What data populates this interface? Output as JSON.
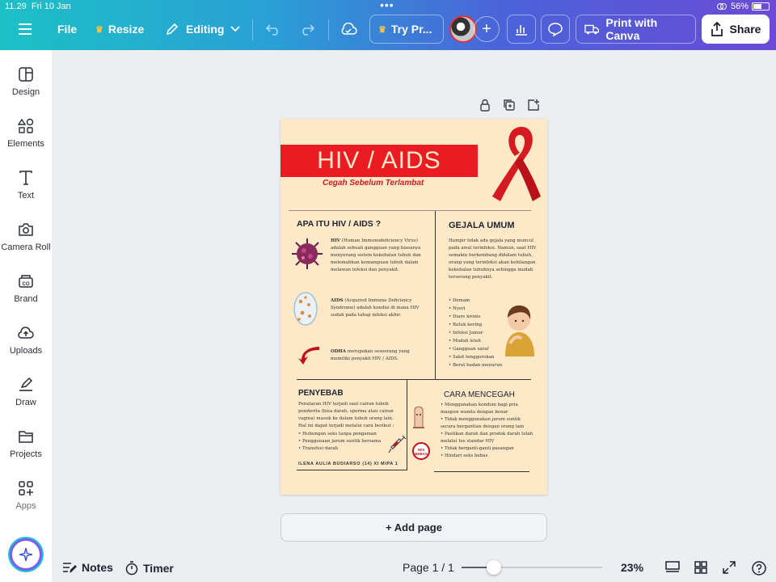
{
  "status": {
    "time": "11.29",
    "date": "Fri 10 Jan",
    "battery": "56%"
  },
  "toolbar": {
    "file": "File",
    "resize": "Resize",
    "mode": "Editing",
    "try_pro": "Try Pr...",
    "print": "Print with Canva",
    "share": "Share"
  },
  "sidebar": {
    "items": [
      {
        "label": "Design",
        "icon": "design-icon"
      },
      {
        "label": "Elements",
        "icon": "elements-icon"
      },
      {
        "label": "Text",
        "icon": "text-icon"
      },
      {
        "label": "Camera Roll",
        "icon": "camera-icon"
      },
      {
        "label": "Brand",
        "icon": "brand-icon"
      },
      {
        "label": "Uploads",
        "icon": "uploads-icon"
      },
      {
        "label": "Draw",
        "icon": "draw-icon"
      },
      {
        "label": "Projects",
        "icon": "folder-icon"
      },
      {
        "label": "Apps",
        "icon": "apps-icon"
      }
    ]
  },
  "poster": {
    "title": "HIV / AIDS",
    "subtitle": "Cegah Sebelum Terlambat",
    "apa_heading": "APA ITU HIV / AIDS ?",
    "hiv_term": "HIV",
    "hiv_text": "(Human Immunodeficiency Virus) adalah sebuah gangguan yang biasanya menyerang sistem kekebalan tubuh dan melemahkan kemampuan tubuh dalam melawan infeksi dan penyakit.",
    "aids_term": "AIDS",
    "aids_text": "(Acquired Immune Deficiency Syndrome) adalah kondisi di mana HIV sudah pada tahap infeksi akhir.",
    "odha_term": "ODHA",
    "odha_text": "merupakan seseorang yang memiliki penyakit HIV / AIDS.",
    "gejala_heading": "GEJALA UMUM",
    "gejala_text": "Hampir tidak ada gejala yang muncul pada awal terinfeksi. Namun, saat HIV semakin berkembang didalam tubuh, orang yang terinfeksi akan kehilangan kekebalan tubuhnya sehingga mudah terserang penyakit.",
    "gejala_list": [
      "Demam",
      "Nyeri",
      "Diare kronis",
      "Batuk kering",
      "Infeksi Jamur",
      "Mudah lelah",
      "Gangguan saraf",
      "Sakit tenggorokan",
      "Berat badan menurun"
    ],
    "penyebab_heading": "PENYEBAB",
    "penyebab_text": "Penularan HIV terjadi saat cairan tubuh penderita (bisa darah, sperma atau cairan vagina) masuk ke dalam tubuh orang lain. Hal ini dapat terjadi melalui cara berikut :",
    "penyebab_list": [
      "Hubungan seks tanpa pengaman",
      "Penggunaan jarum suntik bersama",
      "Transfusi darah"
    ],
    "author": "ILENA AULIA BUDIARSO (14) XI MIPA 1",
    "cara_heading": "CARA MENCEGAH",
    "cara_list": [
      "Menggunakan kondom bagi pria maupun wanita dengan benar",
      "Tidak menggunakan jarum suntik secara bergantian dengan orang lain",
      "Pastikan darah dan produk darah telah melalui tes standar HIV",
      "Tidak berganti-ganti pasangan",
      "Hindari seks bebas"
    ],
    "sign_text": "SEX BEBAS"
  },
  "add_page": "+ Add page",
  "bottom": {
    "notes": "Notes",
    "timer": "Timer",
    "page": "Page 1 / 1",
    "zoom": "23%"
  },
  "zoom_level": 0.23,
  "colors": {
    "accent_red": "#ea1b22",
    "poster_bg": "#fde8c8"
  }
}
